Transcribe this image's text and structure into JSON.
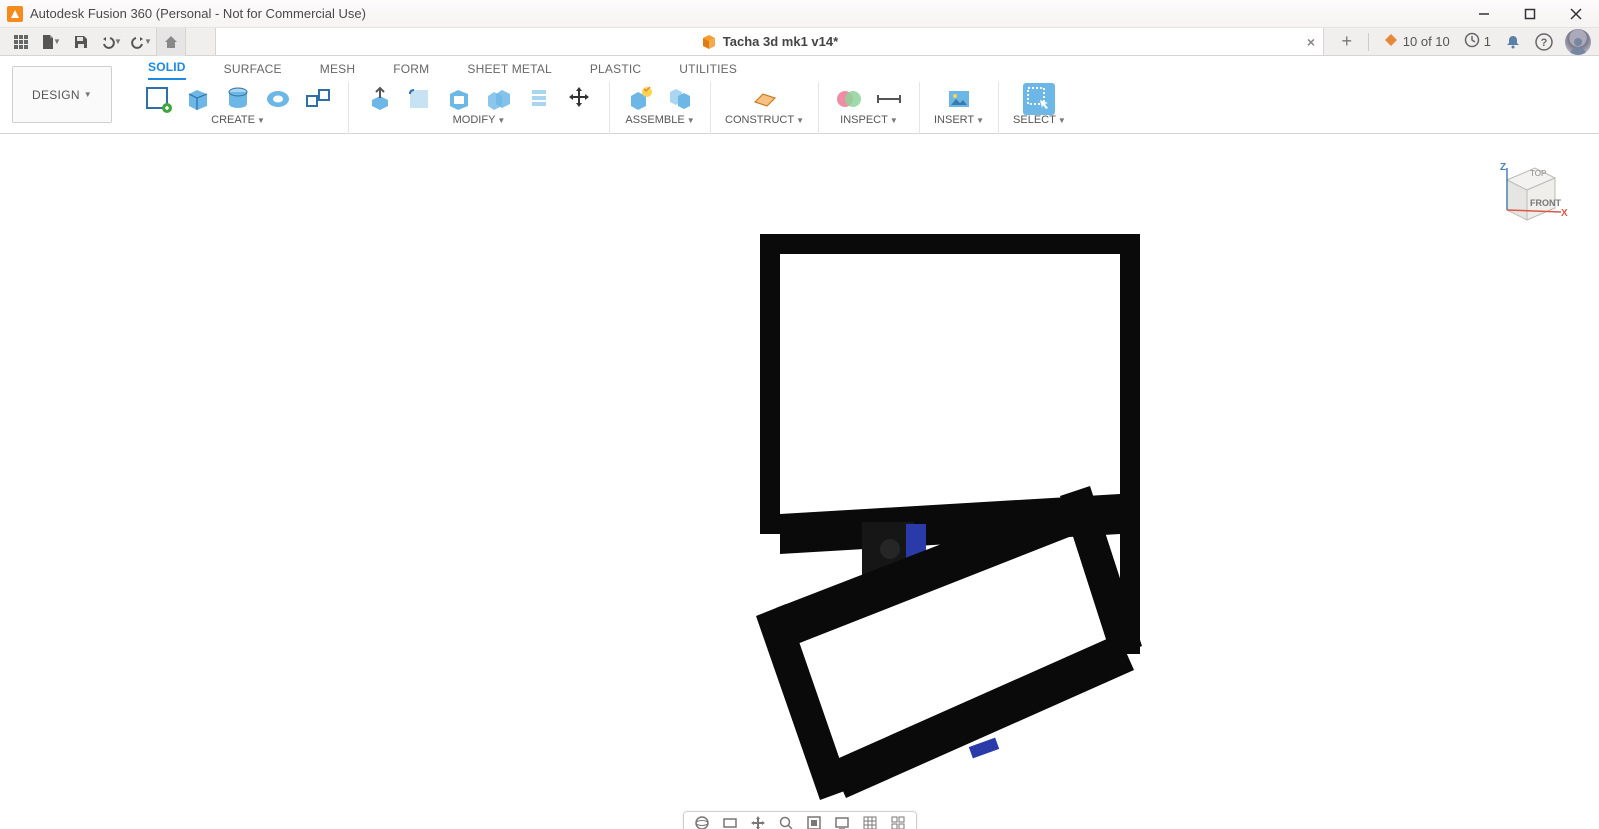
{
  "window": {
    "title": "Autodesk Fusion 360 (Personal - Not for Commercial Use)"
  },
  "document": {
    "name": "Tacha 3d mk1 v14*"
  },
  "status": {
    "extensions": "10 of 10",
    "jobs": "1"
  },
  "workspace": {
    "label": "DESIGN"
  },
  "tabs": {
    "solid": "SOLID",
    "surface": "SURFACE",
    "mesh": "MESH",
    "form": "FORM",
    "sheet_metal": "SHEET METAL",
    "plastic": "PLASTIC",
    "utilities": "UTILITIES"
  },
  "groups": {
    "create": "CREATE",
    "modify": "MODIFY",
    "assemble": "ASSEMBLE",
    "construct": "CONSTRUCT",
    "inspect": "INSPECT",
    "insert": "INSERT",
    "select": "SELECT"
  },
  "viewcube": {
    "front": "FRONT",
    "top": "TOP",
    "z": "Z",
    "x": "X"
  }
}
